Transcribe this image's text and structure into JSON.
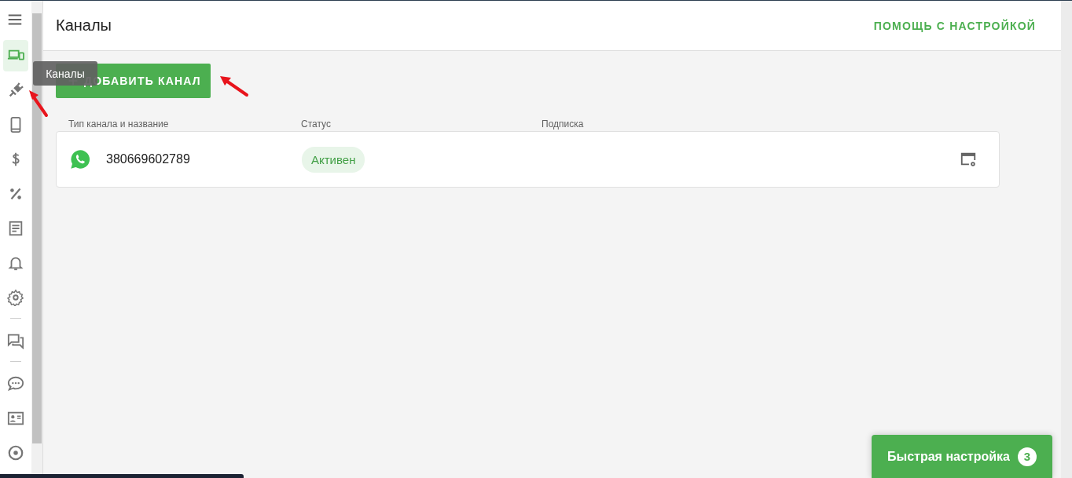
{
  "sidebar": {
    "items": [
      {
        "kind": "item",
        "selected": true
      },
      {
        "kind": "item",
        "selected": false
      },
      {
        "kind": "item",
        "selected": false
      },
      {
        "kind": "item",
        "selected": false
      },
      {
        "kind": "item",
        "selected": false
      },
      {
        "kind": "item",
        "selected": false
      },
      {
        "kind": "item",
        "selected": false
      },
      {
        "kind": "item",
        "selected": false
      },
      {
        "kind": "divider"
      },
      {
        "kind": "item",
        "selected": false
      },
      {
        "kind": "divider"
      },
      {
        "kind": "item",
        "selected": false
      },
      {
        "kind": "item",
        "selected": false
      },
      {
        "kind": "item",
        "selected": false
      }
    ],
    "tooltip": "Каналы"
  },
  "header": {
    "title": "Каналы",
    "help_link": "ПОМОЩЬ С НАСТРОЙКОЙ"
  },
  "add_button": {
    "label": "ДОБАВИТЬ КАНАЛ"
  },
  "table": {
    "columns": [
      "Тип канала и название",
      "Статус",
      "Подписка"
    ],
    "rows": [
      {
        "name": "380669602789",
        "status": "Активен",
        "active": true
      }
    ]
  },
  "quick_setup": {
    "label": "Быстрая настройка",
    "count": "3"
  }
}
